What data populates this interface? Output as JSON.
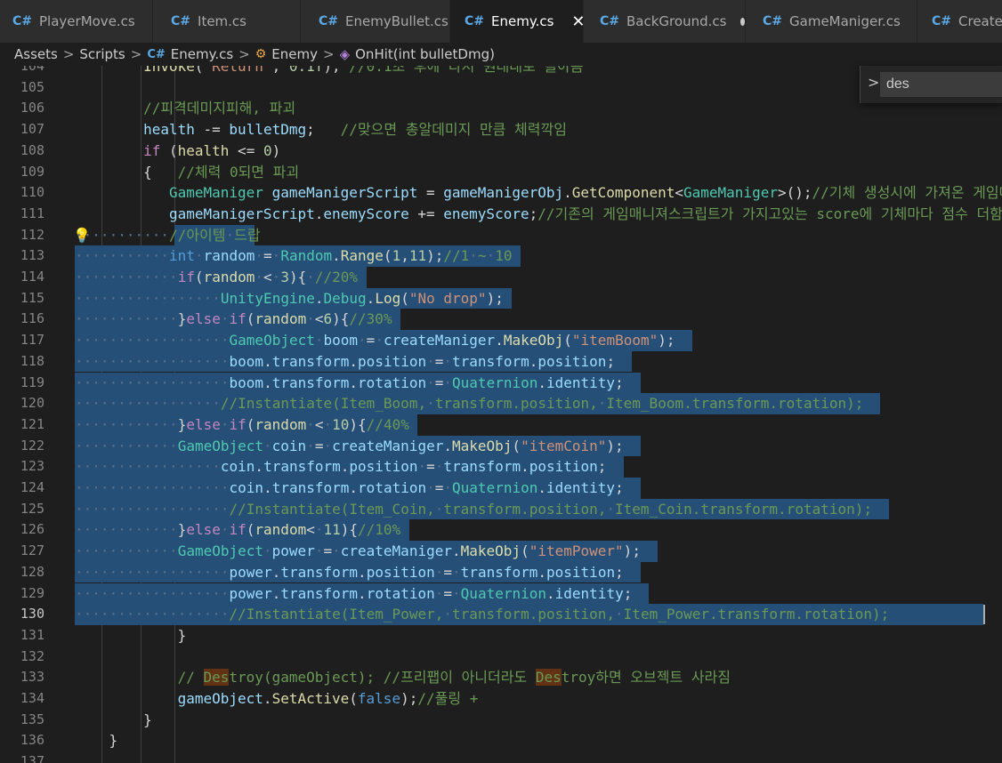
{
  "tabs": [
    {
      "label": "PlayerMove.cs",
      "icon": "csharp-file-icon",
      "icon_glyph": "C#",
      "active": false,
      "modified": false
    },
    {
      "label": "Item.cs",
      "icon": "csharp-file-icon",
      "icon_glyph": "C#",
      "active": false,
      "modified": false
    },
    {
      "label": "EnemyBullet.cs",
      "icon": "csharp-file-icon",
      "icon_glyph": "C#",
      "active": false,
      "modified": false
    },
    {
      "label": "Enemy.cs",
      "icon": "csharp-file-icon",
      "icon_glyph": "C#",
      "active": true,
      "modified": false,
      "close_glyph": "✕"
    },
    {
      "label": "BackGround.cs",
      "icon": "csharp-file-icon",
      "icon_glyph": "C#",
      "active": false,
      "modified": true
    },
    {
      "label": "GameManiger.cs",
      "icon": "csharp-file-icon",
      "icon_glyph": "C#",
      "active": false,
      "modified": false
    },
    {
      "label": "CreateManiger.cs",
      "icon": "csharp-file-icon",
      "icon_glyph": "C#",
      "active": false,
      "modified": false
    }
  ],
  "breadcrumb": {
    "items": [
      "Assets",
      "Scripts",
      "Enemy.cs",
      "Enemy",
      "OnHit(int bulletDmg)"
    ],
    "separator": ">",
    "cs_glyph": "C#",
    "class_glyph": "⚙",
    "method_glyph": "◈"
  },
  "find_widget": {
    "value": "des",
    "toggle_glyph": ">"
  },
  "editor": {
    "current_line": 130,
    "selection_start_line": 112,
    "selection_end_line": 130,
    "lightbulb_line": 112,
    "lightbulb_glyph": "💡",
    "lines": [
      {
        "no": "104",
        "text": "        Invoke(\"Return\", 0.1f); //0.1초 후에 다시 원래대로 돌아옴"
      },
      {
        "no": "105",
        "text": ""
      },
      {
        "no": "106",
        "text": "        //피격데미지피해, 파괴"
      },
      {
        "no": "107",
        "text": "        health -= bulletDmg;   //맞으면 총알데미지 만큼 체력깍임"
      },
      {
        "no": "108",
        "text": "        if (health <= 0)"
      },
      {
        "no": "109",
        "text": "        {   //체력 0되면 파괴"
      },
      {
        "no": "110",
        "text": "           GameManiger gameManigerScript = gameManigerObj.GetComponent<GameManiger>();//기체 생성시에 가져온 게임매니져 오브젝트"
      },
      {
        "no": "111",
        "text": "           gameManigerScript.enemyScore += enemyScore;//기존의 게임매니져스크립트가 가지고있는 score에 기체마다 점수 더함"
      },
      {
        "no": "112",
        "text": "           //아이템 드랍"
      },
      {
        "no": "113",
        "text": "           int random = Random.Range(1,11);//1 ~ 10"
      },
      {
        "no": "114",
        "text": "            if(random < 3){ //20%"
      },
      {
        "no": "115",
        "text": "                 UnityEngine.Debug.Log(\"No drop\");"
      },
      {
        "no": "116",
        "text": "            }else if(random <6){//30%"
      },
      {
        "no": "117",
        "text": "                  GameObject boom = createManiger.MakeObj(\"itemBoom\");"
      },
      {
        "no": "118",
        "text": "                  boom.transform.position = transform.position;"
      },
      {
        "no": "119",
        "text": "                  boom.transform.rotation = Quaternion.identity;"
      },
      {
        "no": "120",
        "text": "                 //Instantiate(Item_Boom, transform.position, Item_Boom.transform.rotation);"
      },
      {
        "no": "121",
        "text": "            }else if(random < 10){//40%"
      },
      {
        "no": "122",
        "text": "            GameObject coin = createManiger.MakeObj(\"itemCoin\");"
      },
      {
        "no": "123",
        "text": "                 coin.transform.position = transform.position;"
      },
      {
        "no": "124",
        "text": "                  coin.transform.rotation = Quaternion.identity;"
      },
      {
        "no": "125",
        "text": "                  //Instantiate(Item_Coin, transform.position, Item_Coin.transform.rotation);"
      },
      {
        "no": "126",
        "text": "            }else if(random< 11){//10%"
      },
      {
        "no": "127",
        "text": "            GameObject power = createManiger.MakeObj(\"itemPower\");"
      },
      {
        "no": "128",
        "text": "                  power.transform.position = transform.position;"
      },
      {
        "no": "129",
        "text": "                  power.transform.rotation = Quaternion.identity;"
      },
      {
        "no": "130",
        "text": "                  //Instantiate(Item_Power, transform.position, Item_Power.transform.rotation);"
      },
      {
        "no": "131",
        "text": "            }"
      },
      {
        "no": "132",
        "text": ""
      },
      {
        "no": "133",
        "text": "            // Destroy(gameObject); //프리팹이 아니더라도 Destroy하면 오브젝트 사라짐"
      },
      {
        "no": "134",
        "text": "            gameObject.SetActive(false);//풀링 +"
      },
      {
        "no": "135",
        "text": "        }"
      },
      {
        "no": "136",
        "text": "    }"
      },
      {
        "no": "137",
        "text": ""
      }
    ]
  }
}
